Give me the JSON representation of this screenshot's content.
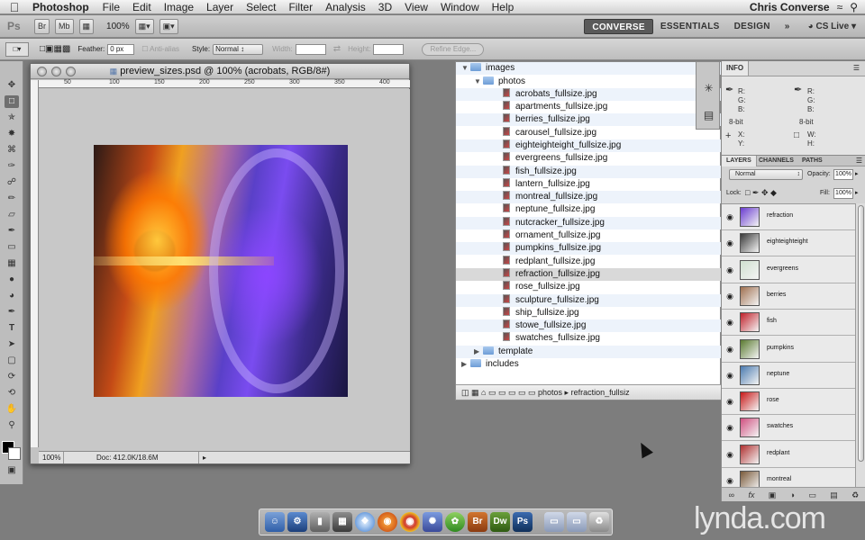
{
  "menubar": {
    "app": "Photoshop",
    "items": [
      "File",
      "Edit",
      "Image",
      "Layer",
      "Select",
      "Filter",
      "Analysis",
      "3D",
      "View",
      "Window",
      "Help"
    ],
    "user": "Chris Converse"
  },
  "appbar": {
    "logo": "Ps",
    "bridge_btn": "Br",
    "mini_btn": "Mb",
    "zoom": "100%",
    "workspaces": [
      "CONVERSE",
      "ESSENTIALS",
      "DESIGN"
    ],
    "more": "»",
    "cs_live": "CS Live"
  },
  "options": {
    "feather_label": "Feather:",
    "feather_value": "0 px",
    "antialias": "Anti-alias",
    "style_label": "Style:",
    "style_value": "Normal",
    "width_label": "Width:",
    "height_label": "Height:",
    "refine_edge": "Refine Edge..."
  },
  "document": {
    "title": "preview_sizes.psd @ 100% (acrobats, RGB/8#)",
    "ruler_marks": [
      "50",
      "100",
      "150",
      "200",
      "250",
      "300",
      "350",
      "400"
    ],
    "status_zoom": "100%",
    "status_doc": "Doc: 412.0K/18.6M"
  },
  "finder": {
    "folders": {
      "images": "images",
      "photos": "photos",
      "template": "template",
      "includes": "includes"
    },
    "files": [
      "acrobats_fullsize.jpg",
      "apartments_fullsize.jpg",
      "berries_fullsize.jpg",
      "carousel_fullsize.jpg",
      "eighteighteight_fullsize.jpg",
      "evergreens_fullsize.jpg",
      "fish_fullsize.jpg",
      "lantern_fullsize.jpg",
      "montreal_fullsize.jpg",
      "neptune_fullsize.jpg",
      "nutcracker_fullsize.jpg",
      "ornament_fullsize.jpg",
      "pumpkins_fullsize.jpg",
      "redplant_fullsize.jpg",
      "refraction_fullsize.jpg",
      "rose_fullsize.jpg",
      "sculpture_fullsize.jpg",
      "ship_fullsize.jpg",
      "stowe_fullsize.jpg",
      "swatches_fullsize.jpg"
    ],
    "selected": "refraction_fullsize.jpg",
    "path": "photos",
    "path_file": "refraction_fullsiz"
  },
  "info_panel": {
    "tab": "INFO",
    "rgb_labels": [
      "R:",
      "G:",
      "B:"
    ],
    "bit_depth": "8-bit",
    "xy_labels": [
      "X:",
      "Y:"
    ],
    "wh_labels": [
      "W:",
      "H:"
    ]
  },
  "layers_panel": {
    "tabs": [
      "LAYERS",
      "CHANNELS",
      "PATHS"
    ],
    "blend_mode": "Normal",
    "opacity_label": "Opacity:",
    "opacity": "100%",
    "lock_label": "Lock:",
    "fill_label": "Fill:",
    "fill": "100%",
    "layers": [
      {
        "name": "refraction",
        "color": "#6a3cd0"
      },
      {
        "name": "eighteighteight",
        "color": "#3a3a3a"
      },
      {
        "name": "evergreens",
        "color": "#cfe0cf"
      },
      {
        "name": "berries",
        "color": "#a07050"
      },
      {
        "name": "fish",
        "color": "#c0202a"
      },
      {
        "name": "pumpkins",
        "color": "#5a7a30"
      },
      {
        "name": "neptune",
        "color": "#4a7ab0"
      },
      {
        "name": "rose",
        "color": "#c81818"
      },
      {
        "name": "swatches",
        "color": "#d05080"
      },
      {
        "name": "redplant",
        "color": "#b03030"
      },
      {
        "name": "montreal",
        "color": "#7a5a3a"
      }
    ]
  },
  "dock": {
    "labels": [
      "Br",
      "Dw",
      "Ps"
    ]
  },
  "watermark": "lynda.com"
}
